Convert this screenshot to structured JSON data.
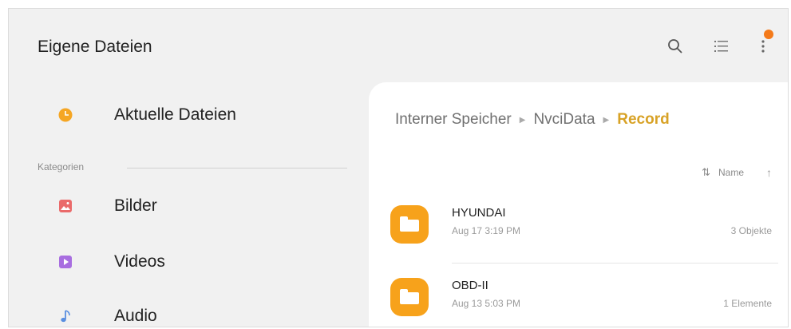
{
  "app": {
    "title": "Eigene Dateien"
  },
  "toolbar": {
    "search_icon": "search-icon",
    "list_icon": "list-view-icon",
    "more_icon": "more-vert-icon",
    "badge_color": "#f47a1a"
  },
  "sidebar": {
    "recent": {
      "label": "Aktuelle Dateien",
      "icon": "clock-icon",
      "color": "#f5a623"
    },
    "categories_label": "Kategorien",
    "items": [
      {
        "label": "Bilder",
        "icon": "image-icon",
        "color": "#ea6a6a"
      },
      {
        "label": "Videos",
        "icon": "video-icon",
        "color": "#a86ee0"
      },
      {
        "label": "Audio",
        "icon": "audio-icon",
        "color": "#5a8fe0"
      }
    ]
  },
  "breadcrumb": {
    "items": [
      "Interner Speicher",
      "NvciData"
    ],
    "current": "Record",
    "accent_color": "#d8a226"
  },
  "sort": {
    "label": "Name",
    "icon": "sort-icon",
    "direction_icon": "arrow-up-icon"
  },
  "files": [
    {
      "name": "HYUNDAI",
      "date": "Aug 17 3:19 PM",
      "count": "3 Objekte"
    },
    {
      "name": "OBD-II",
      "date": "Aug 13 5:03 PM",
      "count": "1 Elemente"
    }
  ],
  "folder_color": "#f7a21b"
}
